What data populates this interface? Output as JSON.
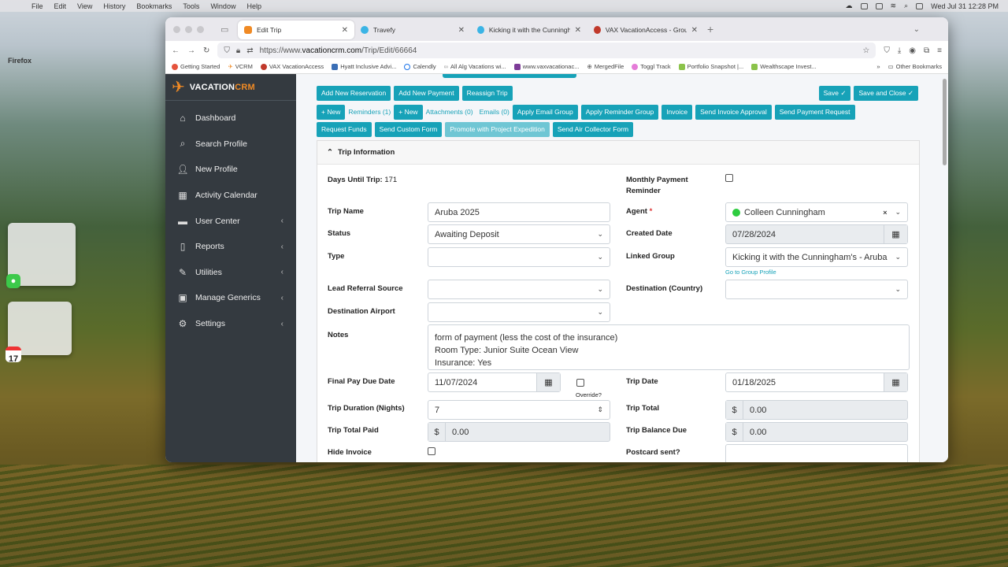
{
  "menubar": {
    "app": "Firefox",
    "items": [
      "File",
      "Edit",
      "View",
      "History",
      "Bookmarks",
      "Tools",
      "Window",
      "Help"
    ],
    "clock": "Wed Jul 31  12:28 PM"
  },
  "browser": {
    "tabs": [
      {
        "title": "Edit Trip",
        "active": true
      },
      {
        "title": "Travefy",
        "active": false
      },
      {
        "title": "Kicking it with the Cunningham",
        "active": false
      },
      {
        "title": "VAX VacationAccess - Group R",
        "active": false
      }
    ],
    "url_prefix": "https://www.",
    "url_domain": "vacationcrm.com",
    "url_path": "/Trip/Edit/66664",
    "bookmarks": [
      "Getting Started",
      "VCRM",
      "VAX VacationAccess",
      "Hyatt Inclusive Advi...",
      "Calendly",
      "All Alg Vacations wi...",
      "www.vaxvacationac...",
      "MergedFile",
      "Toggl Track",
      "Portfolio Snapshot |...",
      "Wealthscape Invest...",
      "Other Bookmarks"
    ]
  },
  "sidebar": {
    "logo_main": "VACATION",
    "logo_accent": "CRM",
    "items": [
      {
        "label": "Dashboard"
      },
      {
        "label": "Search Profile"
      },
      {
        "label": "New Profile"
      },
      {
        "label": "Activity Calendar"
      },
      {
        "label": "User Center"
      },
      {
        "label": "Reports"
      },
      {
        "label": "Utilities"
      },
      {
        "label": "Manage Generics"
      },
      {
        "label": "Settings"
      }
    ]
  },
  "toolbar": {
    "add_reservation": "Add New Reservation",
    "add_payment": "Add New Payment",
    "reassign_trip": "Reassign Trip",
    "save": "Save",
    "save_close": "Save and Close",
    "new1": "New",
    "reminders": "Reminders (1)",
    "new2": "New",
    "attachments": "Attachments (0)",
    "emails": "Emails (0)",
    "apply_email_group": "Apply Email Group",
    "apply_reminder_group": "Apply Reminder Group",
    "invoice": "Invoice",
    "send_invoice_approval": "Send Invoice Approval",
    "send_payment_request": "Send Payment Request",
    "request_funds": "Request Funds",
    "send_custom_form": "Send Custom Form",
    "promote_project_expedition": "Promote with Project Expedition",
    "send_air_collector": "Send Air Collector Form"
  },
  "trip": {
    "section_title": "Trip Information",
    "days_until_label": "Days Until Trip:",
    "days_until_value": "171",
    "monthly_reminder_label": "Monthly Payment Reminder",
    "trip_name_label": "Trip Name",
    "trip_name": "Aruba 2025",
    "agent_label": "Agent",
    "agent": "Colleen Cunningham",
    "status_label": "Status",
    "status": "Awaiting Deposit",
    "created_date_label": "Created Date",
    "created_date": "07/28/2024",
    "type_label": "Type",
    "type": "",
    "linked_group_label": "Linked Group",
    "linked_group": "Kicking it with the Cunningham's - Aruba",
    "go_to_group": "Go to Group Profile",
    "lead_referral_label": "Lead Referral Source",
    "destination_country_label": "Destination (Country)",
    "destination_airport_label": "Destination Airport",
    "notes_label": "Notes",
    "notes_lines": [
      "form of payment (less the cost of the insurance)",
      "Room Type: Junior Suite Ocean View",
      "Insurance: Yes"
    ],
    "final_pay_label": "Final Pay Due Date",
    "final_pay": "11/07/2024",
    "override_label": "Override?",
    "trip_date_label": "Trip Date",
    "trip_date": "01/18/2025",
    "duration_label": "Trip Duration (Nights)",
    "duration": "7",
    "trip_total_label": "Trip Total",
    "trip_total": "0.00",
    "total_paid_label": "Trip Total Paid",
    "total_paid": "0.00",
    "balance_due_label": "Trip Balance Due",
    "balance_due": "0.00",
    "hide_invoice_label": "Hide Invoice",
    "postcard_label": "Postcard sent?",
    "currency": "$"
  },
  "colors": {
    "accent": "#17a2b8",
    "sidebar": "#343a40",
    "brand_orange": "#f08a24"
  }
}
